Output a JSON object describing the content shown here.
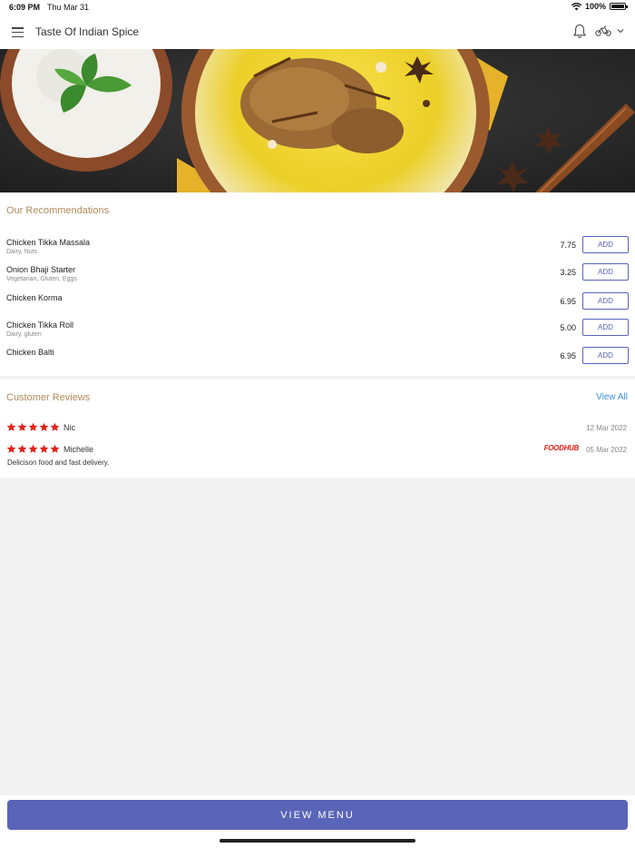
{
  "status_bar": {
    "time": "6:09 PM",
    "date": "Thu Mar 31",
    "battery": "100%",
    "battery_level": 1.0
  },
  "header": {
    "title": "Taste Of Indian Spice",
    "icons": [
      "menu-icon",
      "bell-icon",
      "bike-icon",
      "chevron-down-icon"
    ]
  },
  "hero": {
    "image": "biryani-with-raita"
  },
  "recommendations": {
    "title": "Our Recommendations",
    "add_label": "ADD",
    "items": [
      {
        "name": "Chicken Tikka Massala",
        "tags": "Dairy, Nuts",
        "price": "7.75"
      },
      {
        "name": "Onion Bhaji Starter",
        "tags": "Vegetarian, Gluten, Eggs",
        "price": "3.25"
      },
      {
        "name": "Chicken Korma",
        "tags": "",
        "price": "6.95"
      },
      {
        "name": "Chicken Tikka Roll",
        "tags": "Dairy, gluten",
        "price": "5.00"
      },
      {
        "name": "Chicken Balti",
        "tags": "",
        "price": "6.95"
      }
    ]
  },
  "reviews": {
    "title": "Customer Reviews",
    "view_all": "View All",
    "items": [
      {
        "rating": 5,
        "name": "Nic",
        "date": "12 Mar 2022",
        "source": "",
        "text": ""
      },
      {
        "rating": 5,
        "name": "Michelle",
        "date": "05 Mar 2022",
        "source": "FOODHUB",
        "text": "Delicison food and fast delivery."
      }
    ]
  },
  "footer": {
    "view_menu": "VIEW MENU"
  },
  "colors": {
    "accent": "#5a64b8",
    "section_title": "#b08a5a",
    "link": "#3a8fd6",
    "star": "#e2231a",
    "brand": "#e2231a"
  }
}
